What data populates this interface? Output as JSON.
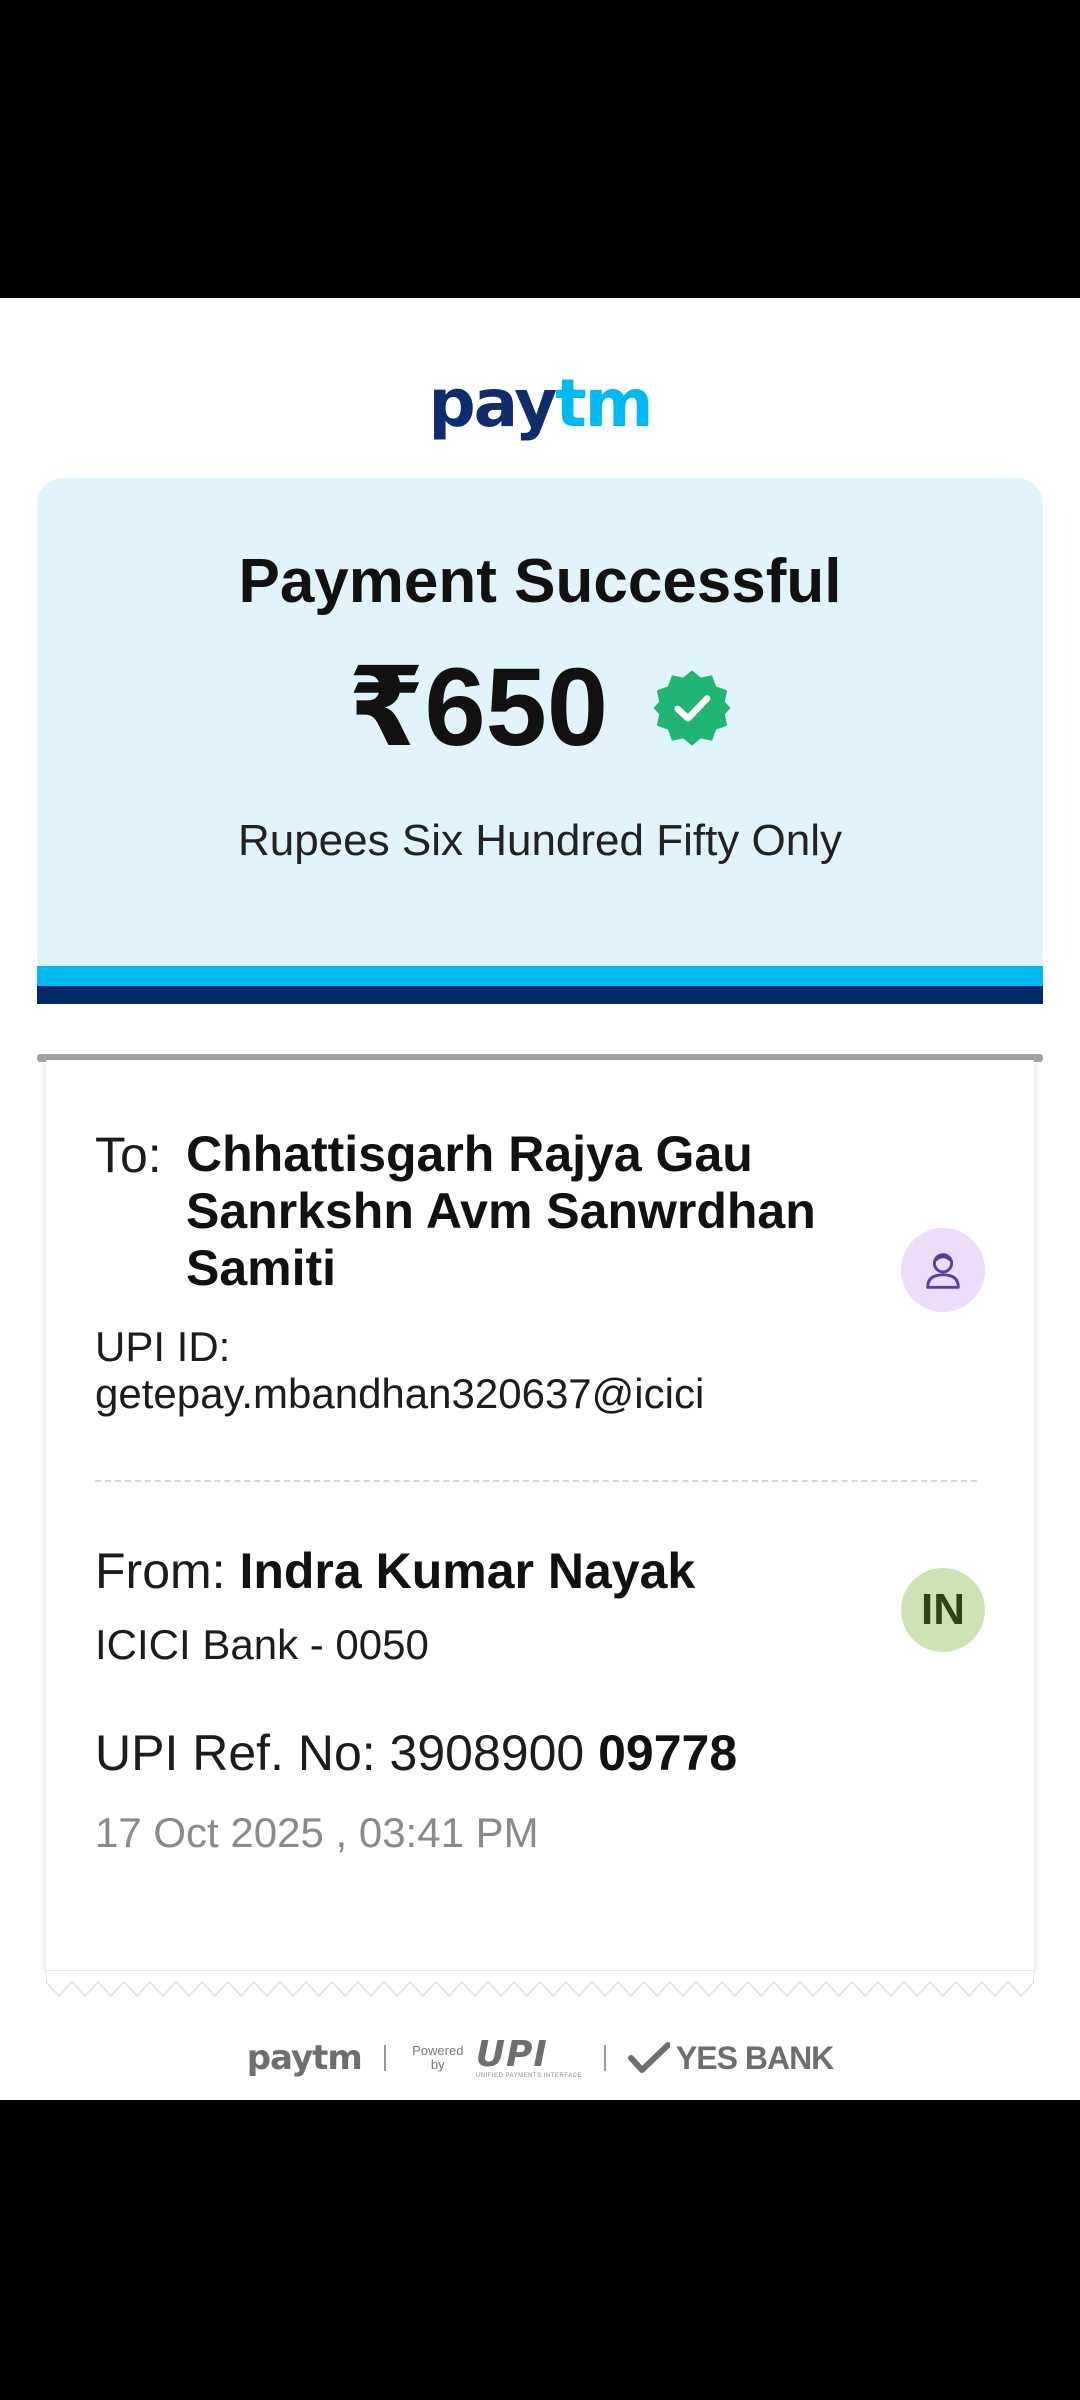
{
  "header": {
    "logo_part1": "pay",
    "logo_part2": "tm"
  },
  "payment": {
    "status_title": "Payment Successful",
    "amount": "₹650",
    "amount_in_words": "Rupees Six Hundred Fifty Only",
    "status_icon": "verified-check-badge-icon"
  },
  "recipient": {
    "to_label": "To:",
    "name": "Chhattisgarh Rajya Gau Sanrkshn Avm Sanwrdhan Samiti",
    "upi_id_label": "UPI ID:",
    "upi_id": "getepay.mbandhan320637@icici",
    "avatar_icon": "person-icon"
  },
  "sender": {
    "from_label": "From:",
    "name": "Indra Kumar Nayak",
    "bank": "ICICI Bank - 0050",
    "avatar_initials": "IN"
  },
  "transaction": {
    "ref_label": "UPI Ref. No:",
    "ref_part1": "3908900",
    "ref_part2": "09778",
    "datetime": "17 Oct 2025 , 03:41 PM"
  },
  "footer": {
    "paytm": "paytm",
    "powered_by": "Powered by",
    "upi": "UPI",
    "upi_subtitle": "UNIFIED PAYMENTS INTERFACE",
    "bank_partner": "YES BANK"
  },
  "colors": {
    "brand_dark": "#0f2d6b",
    "brand_light": "#00b9f1",
    "success_green": "#21b573",
    "card_background": "#e1f3fb",
    "band_dark": "#02296b"
  }
}
